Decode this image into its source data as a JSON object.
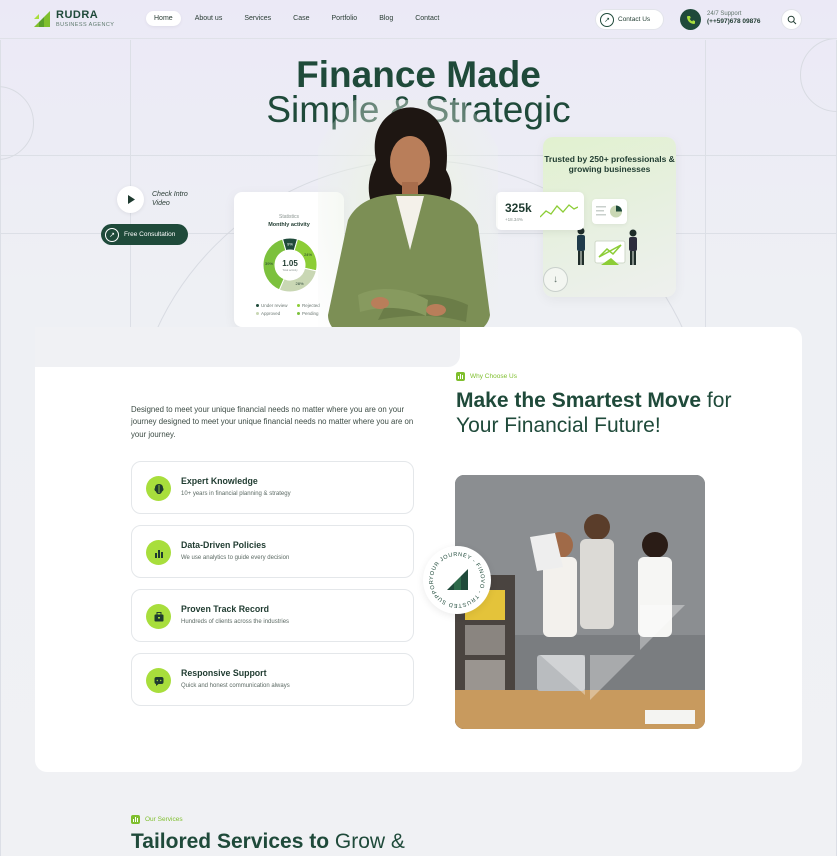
{
  "brand": {
    "name": "RUDRA",
    "tagline": "BUSINESS AGENCY"
  },
  "nav": {
    "items": [
      {
        "label": "Home",
        "active": true
      },
      {
        "label": "About us"
      },
      {
        "label": "Services"
      },
      {
        "label": "Case"
      },
      {
        "label": "Portfolio"
      },
      {
        "label": "Blog"
      },
      {
        "label": "Contact"
      }
    ],
    "contact_button": "Contact Us",
    "support_label": "24/7 Support",
    "support_phone": "(++597)678 09876"
  },
  "hero": {
    "title_line1": "Finance Made",
    "title_line2": "Simple & Strategic",
    "video_label": "Check Intro Video",
    "consult_button": "Free Consultation"
  },
  "stats_card": {
    "label": "Statistics",
    "title": "Monthly activity",
    "center_value": "1.05",
    "center_sub": "Total activity",
    "segments": [
      {
        "label": "9%",
        "value": 9,
        "color": "#1f4a3a"
      },
      {
        "label": "24%",
        "value": 24,
        "color": "#8ccd36"
      },
      {
        "label": "28%",
        "value": 28,
        "color": "#c9d7b4"
      },
      {
        "label": "39%",
        "value": 39,
        "color": "#7cc13d"
      }
    ],
    "legend": [
      {
        "label": "Under review",
        "color": "#1f4a3a"
      },
      {
        "label": "Rejected",
        "color": "#8ccd36"
      },
      {
        "label": "Approved",
        "color": "#c9d7b4"
      },
      {
        "label": "Pending",
        "color": "#7cc13d"
      }
    ]
  },
  "trust": {
    "text": "Trusted by 250+ professionals & growing businesses",
    "metric_value": "325k",
    "metric_sub": "+18.34%"
  },
  "intro": {
    "text": "Designed to meet your unique financial needs no matter where you are on your journey designed to meet your unique financial needs no matter where you are on your journey."
  },
  "features": [
    {
      "title": "Expert Knowledge",
      "desc": "10+ years in financial planning & strategy",
      "icon": "brain-icon"
    },
    {
      "title": "Data-Driven Policies",
      "desc": "We use analytics to guide every decision",
      "icon": "bar-chart-icon"
    },
    {
      "title": "Proven Track Record",
      "desc": "Hundreds of clients across the industries",
      "icon": "briefcase-icon"
    },
    {
      "title": "Responsive Support",
      "desc": "Quick and honest communication always",
      "icon": "chat-icon"
    }
  ],
  "why": {
    "tag": "Why Choose Us",
    "title_bold": "Make the Smartest Move",
    "title_rest": " for Your Financial Future!",
    "badge_text": "YOUR JOURNEY - FINOVO - TRUSTED SUPPORT FOR "
  },
  "services": {
    "tag": "Our Services",
    "title_bold": "Tailored Services to",
    "title_rest": " Grow &"
  },
  "colors": {
    "primary": "#1f4a3a",
    "accent": "#a8de3c",
    "accent_dark": "#7fbf2e"
  }
}
